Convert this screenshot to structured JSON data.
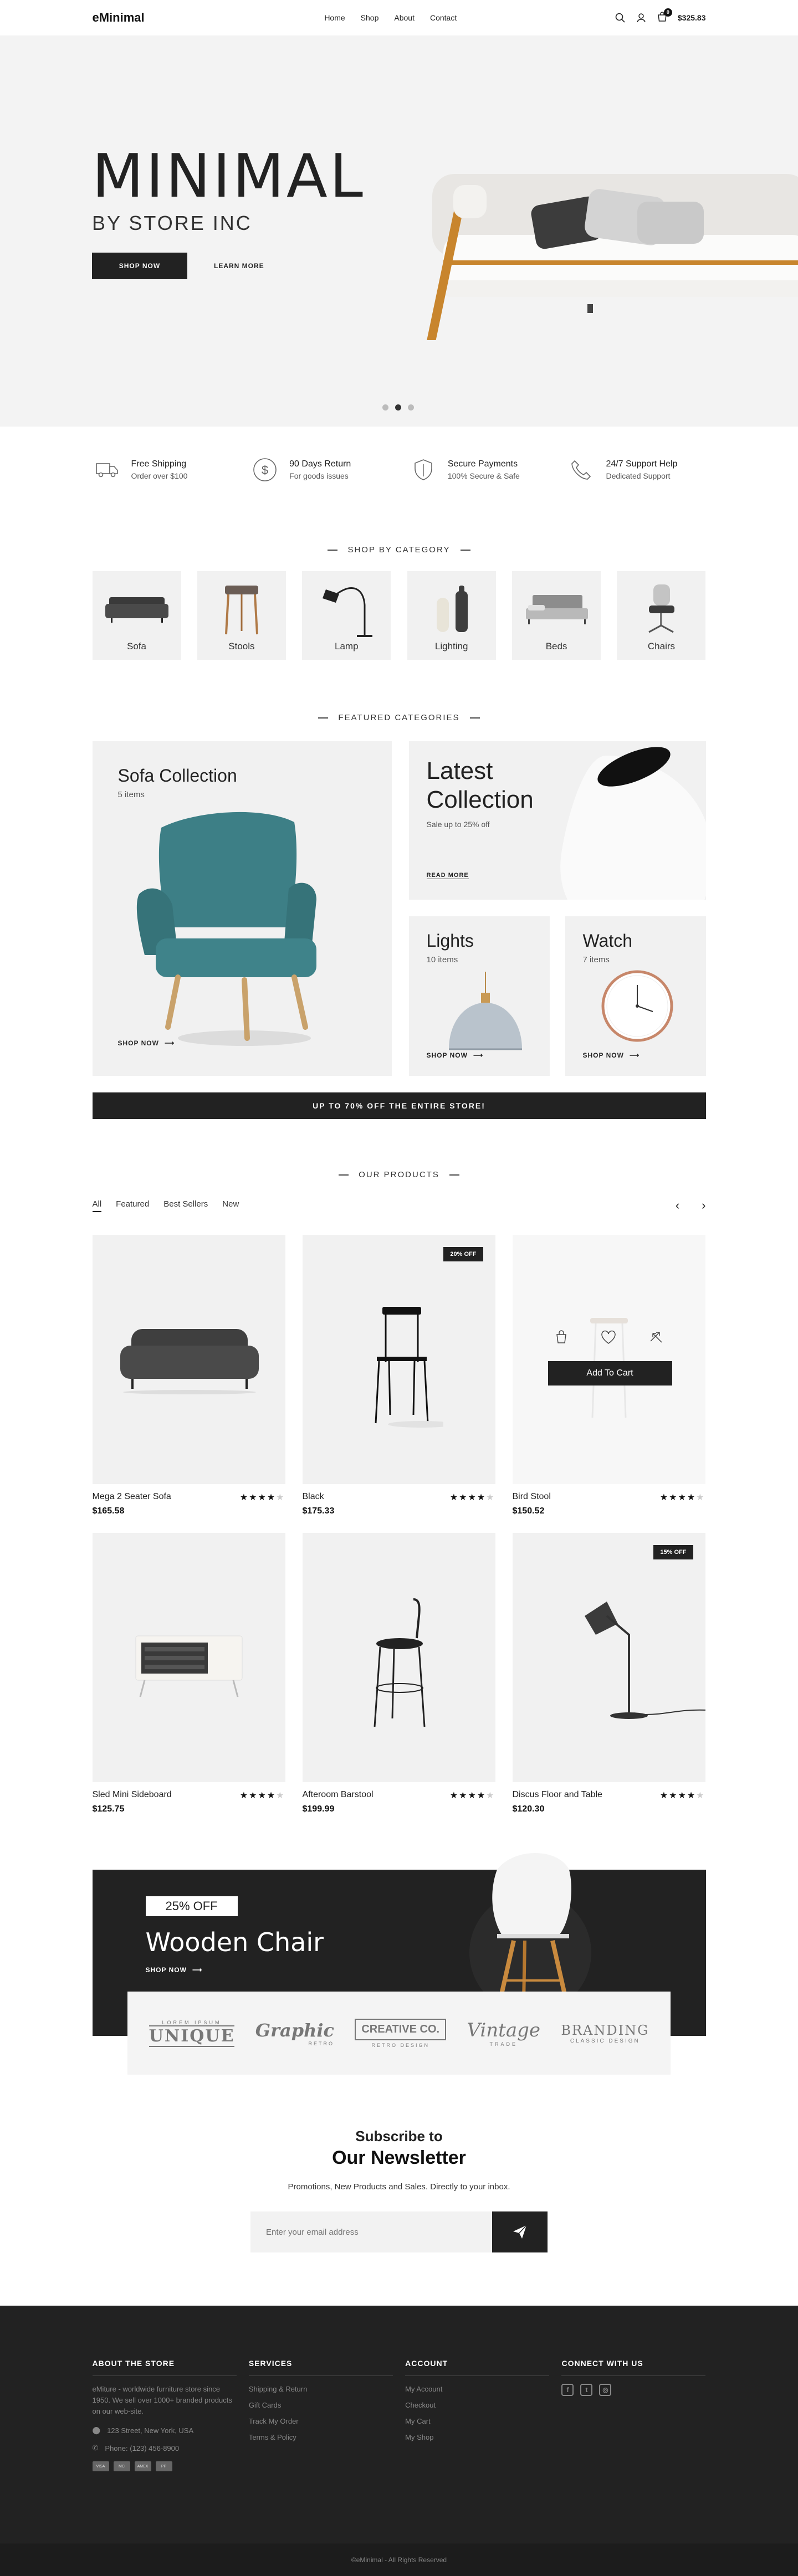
{
  "header": {
    "logo": "eMinimal",
    "nav": [
      "Home",
      "Shop",
      "About",
      "Contact"
    ],
    "cart_count": "0",
    "cart_total": "$325.83"
  },
  "hero": {
    "title": "MINIMAL",
    "subtitle": "BY STORE INC",
    "shop_btn": "SHOP NOW",
    "learn_btn": "LEARN MORE",
    "slides": 3,
    "active_slide": 2
  },
  "features": [
    {
      "title": "Free Shipping",
      "text": "Order over $100",
      "icon": "truck-icon"
    },
    {
      "title": "90 Days Return",
      "text": "For goods issues",
      "icon": "dollar-icon"
    },
    {
      "title": "Secure Payments",
      "text": "100% Secure & Safe",
      "icon": "shield-icon"
    },
    {
      "title": "24/7 Support Help",
      "text": "Dedicated Support",
      "icon": "phone-icon"
    }
  ],
  "categories": {
    "title": "SHOP BY CATEGORY",
    "items": [
      "Sofa",
      "Stools",
      "Lamp",
      "Lighting",
      "Beds",
      "Chairs"
    ]
  },
  "featured": {
    "title": "FEATURED CATEGORIES",
    "sofa": {
      "title": "Sofa Collection",
      "count": "5 items",
      "cta": "SHOP NOW"
    },
    "latest": {
      "title1": "Latest",
      "title2": "Collection",
      "text": "Sale up to 25% off",
      "cta": "READ MORE"
    },
    "lights": {
      "title": "Lights",
      "count": "10 items",
      "cta": "SHOP NOW"
    },
    "watch": {
      "title": "Watch",
      "count": "7 items",
      "cta": "SHOP NOW"
    },
    "banner": "UP TO 70% OFF THE ENTIRE STORE!"
  },
  "products": {
    "title": "OUR PRODUCTS",
    "tabs": [
      "All",
      "Featured",
      "Best Sellers",
      "New"
    ],
    "add_to_cart": "Add To Cart",
    "items": [
      {
        "name": "Mega 2 Seater Sofa",
        "price": "$165.58",
        "rating": 4,
        "badge": ""
      },
      {
        "name": "Black",
        "price": "$175.33",
        "rating": 4,
        "badge": "20% OFF"
      },
      {
        "name": "Bird Stool",
        "price": "$150.52",
        "rating": 4,
        "badge": ""
      },
      {
        "name": "Sled Mini Sideboard",
        "price": "$125.75",
        "rating": 4,
        "badge": ""
      },
      {
        "name": "Afteroom Barstool",
        "price": "$199.99",
        "rating": 4,
        "badge": ""
      },
      {
        "name": "Discus Floor and Table",
        "price": "$120.30",
        "rating": 4,
        "badge": "15% OFF"
      }
    ]
  },
  "promo": {
    "tag": "25% OFF",
    "title": "Wooden Chair",
    "cta": "SHOP NOW"
  },
  "brands": [
    {
      "top": "LOREM IPSUM",
      "main": "UNIQUE",
      "sub": ""
    },
    {
      "top": "",
      "main": "Graphic",
      "sub": "RETRO"
    },
    {
      "top": "",
      "main": "CREATIVE CO.",
      "sub": "RETRO DESIGN"
    },
    {
      "top": "",
      "main": "Vintage",
      "sub": "TRADE"
    },
    {
      "top": "",
      "main": "BRANDING",
      "sub": "CLASSIC DESIGN"
    }
  ],
  "newsletter": {
    "line1": "Subscribe to",
    "line2": "Our Newsletter",
    "text": "Promotions, New Products and Sales. Directly to your inbox.",
    "placeholder": "Enter your email address"
  },
  "footer": {
    "about": {
      "title": "ABOUT THE STORE",
      "text": "eMiture - worldwide furniture store since 1950. We sell over 1000+ branded products on our web-site.",
      "address": "123 Street, New York, USA",
      "phone": "Phone: (123) 456-8900",
      "cards": [
        "VISA",
        "MC",
        "AMEX",
        "PP"
      ]
    },
    "services": {
      "title": "SERVICES",
      "links": [
        "Shipping & Return",
        "Gift Cards",
        "Track My Order",
        "Terms & Policy"
      ]
    },
    "account": {
      "title": "ACCOUNT",
      "links": [
        "My Account",
        "Checkout",
        "My Cart",
        "My Shop"
      ]
    },
    "connect": {
      "title": "CONNECT WITH US",
      "icons": [
        "facebook-icon",
        "twitter-icon",
        "instagram-icon"
      ]
    },
    "copyright": "©eMinimal - All Rights Reserved"
  },
  "colors": {
    "dark": "#222222",
    "light_bg": "#f1f1f1",
    "accent_teal": "#3f7f85"
  }
}
